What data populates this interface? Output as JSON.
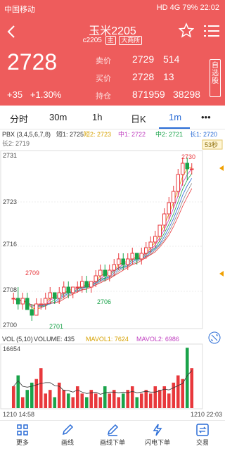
{
  "status": {
    "carrier": "中国移动",
    "network": "HD 4G",
    "battery": "79%",
    "time": "22:02"
  },
  "header": {
    "title": "玉米2205",
    "code": "c2205",
    "tag1": "主",
    "tag2": "大商所",
    "price": "2728",
    "change": "+35",
    "change_pct": "+1.30%",
    "quotes": [
      {
        "label": "卖价",
        "v1": "2729",
        "v2": "514"
      },
      {
        "label": "买价",
        "v1": "2728",
        "v2": "13"
      },
      {
        "label": "持仓",
        "v1": "871959",
        "v2": "38298"
      }
    ],
    "side_button": "自选股"
  },
  "tabs": [
    "分时",
    "30m",
    "1h",
    "日K",
    "1m",
    "•••"
  ],
  "active_tab": "1m",
  "chart_info": {
    "indicator": "PBX (3,4,5,6,7,8)",
    "d1": "短1: 2725",
    "d2": "短2: 2723",
    "m1": "中1: 2722",
    "m2": "中2: 2721",
    "l1": "长1: 2720",
    "l2": "长2: 2719",
    "countdown": "53秒",
    "price_ticks": [
      "2731",
      "2723",
      "2716",
      "2708",
      "2700"
    ],
    "annot_high": "2730",
    "annot_mid": "2709",
    "annot_low": "2701",
    "annot_ma": "2706",
    "vol_indicator": "VOL (5,10)",
    "volume": "VOLUME: 435",
    "mavol1": "MAVOL1: 7624",
    "mavol2": "MAVOL2: 6986",
    "vol_max": "16654",
    "time_start": "1210 14:58",
    "time_end": "1210 22:03"
  },
  "colors": {
    "up": "#e8383c",
    "down": "#1aa34a",
    "accent": "#ee5c5c",
    "blue": "#2a6cd6"
  },
  "chart_data": {
    "type": "candlestick",
    "ylim": [
      2700,
      2731
    ],
    "candles": [
      [
        2705,
        2706,
        2704,
        2705
      ],
      [
        2705,
        2707,
        2703,
        2704
      ],
      [
        2704,
        2706,
        2703,
        2705
      ],
      [
        2705,
        2706,
        2703,
        2703
      ],
      [
        2703,
        2704,
        2701,
        2702
      ],
      [
        2702,
        2705,
        2702,
        2704
      ],
      [
        2704,
        2705,
        2703,
        2704
      ],
      [
        2704,
        2706,
        2703,
        2705
      ],
      [
        2705,
        2707,
        2704,
        2706
      ],
      [
        2706,
        2706,
        2704,
        2705
      ],
      [
        2705,
        2707,
        2704,
        2706
      ],
      [
        2706,
        2708,
        2705,
        2707
      ],
      [
        2707,
        2708,
        2705,
        2706
      ],
      [
        2706,
        2707,
        2705,
        2707
      ],
      [
        2707,
        2708,
        2706,
        2707
      ],
      [
        2707,
        2709,
        2706,
        2708
      ],
      [
        2708,
        2709,
        2706,
        2707
      ],
      [
        2707,
        2708,
        2706,
        2708
      ],
      [
        2708,
        2710,
        2707,
        2709
      ],
      [
        2709,
        2711,
        2708,
        2710
      ],
      [
        2710,
        2711,
        2708,
        2709
      ],
      [
        2709,
        2711,
        2708,
        2710
      ],
      [
        2710,
        2712,
        2709,
        2711
      ],
      [
        2711,
        2713,
        2710,
        2712
      ],
      [
        2712,
        2713,
        2710,
        2711
      ],
      [
        2711,
        2713,
        2710,
        2712
      ],
      [
        2712,
        2714,
        2711,
        2713
      ],
      [
        2713,
        2713,
        2711,
        2712
      ],
      [
        2712,
        2714,
        2711,
        2713
      ],
      [
        2713,
        2715,
        2712,
        2714
      ],
      [
        2714,
        2716,
        2713,
        2715
      ],
      [
        2715,
        2717,
        2714,
        2716
      ],
      [
        2716,
        2718,
        2715,
        2718
      ],
      [
        2718,
        2721,
        2717,
        2720
      ],
      [
        2720,
        2723,
        2719,
        2722
      ],
      [
        2722,
        2725,
        2721,
        2724
      ],
      [
        2724,
        2728,
        2723,
        2727
      ],
      [
        2727,
        2730,
        2725,
        2729
      ],
      [
        2729,
        2730,
        2726,
        2728
      ],
      [
        2728,
        2729,
        2727,
        2728
      ]
    ],
    "volumes": [
      6,
      9,
      3,
      5,
      7,
      8,
      11,
      4,
      5,
      3,
      7,
      5,
      4,
      3,
      6,
      4,
      3,
      5,
      4,
      3,
      6,
      4,
      5,
      3,
      4,
      5,
      6,
      3,
      4,
      5,
      4,
      6,
      5,
      6,
      4,
      7,
      9,
      8,
      16.6,
      11
    ]
  }
}
